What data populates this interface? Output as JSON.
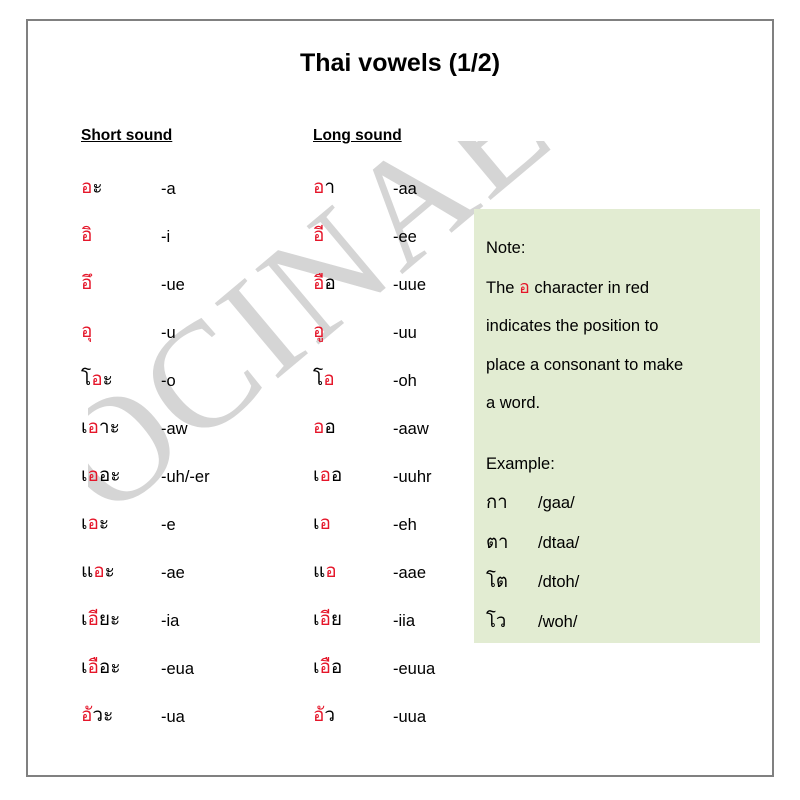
{
  "page": {
    "title": "Thai vowels (1/2)",
    "watermark": "OCINAE",
    "border_color": "#808080",
    "red_accent": "#e5162a",
    "note_bg": "#e2ecd2"
  },
  "columns": {
    "short_header": "Short sound",
    "long_header": "Long sound"
  },
  "short_sounds": [
    {
      "thai_pre": "",
      "thai_placeholder": "อ",
      "thai_post": "ะ",
      "roman": "-a"
    },
    {
      "thai_pre": "",
      "thai_placeholder": "อิ",
      "thai_post": "",
      "roman": "-i"
    },
    {
      "thai_pre": "",
      "thai_placeholder": "อึ",
      "thai_post": "",
      "roman": "-ue"
    },
    {
      "thai_pre": "",
      "thai_placeholder": "อุ",
      "thai_post": "",
      "roman": "-u"
    },
    {
      "thai_pre": "โ",
      "thai_placeholder": "อ",
      "thai_post": "ะ",
      "roman": "-o"
    },
    {
      "thai_pre": "เ",
      "thai_placeholder": "อ",
      "thai_post": "าะ",
      "roman": "-aw"
    },
    {
      "thai_pre": "เ",
      "thai_placeholder": "อ",
      "thai_post": "อะ",
      "roman": "-uh/-er"
    },
    {
      "thai_pre": "เ",
      "thai_placeholder": "อ",
      "thai_post": "ะ",
      "roman": "-e"
    },
    {
      "thai_pre": "แ",
      "thai_placeholder": "อ",
      "thai_post": "ะ",
      "roman": "-ae"
    },
    {
      "thai_pre": "เ",
      "thai_placeholder": "อี",
      "thai_post": "ยะ",
      "roman": "-ia"
    },
    {
      "thai_pre": "เ",
      "thai_placeholder": "อื",
      "thai_post": "อะ",
      "roman": "-eua"
    },
    {
      "thai_pre": "",
      "thai_placeholder": "อั",
      "thai_post": "วะ",
      "roman": "-ua"
    }
  ],
  "long_sounds": [
    {
      "thai_pre": "",
      "thai_placeholder": "อ",
      "thai_post": "า",
      "roman": "-aa"
    },
    {
      "thai_pre": "",
      "thai_placeholder": "อี",
      "thai_post": "",
      "roman": "-ee"
    },
    {
      "thai_pre": "",
      "thai_placeholder": "อื",
      "thai_post": "อ",
      "roman": "-uue"
    },
    {
      "thai_pre": "",
      "thai_placeholder": "อู",
      "thai_post": "",
      "roman": "-uu"
    },
    {
      "thai_pre": "โ",
      "thai_placeholder": "อ",
      "thai_post": "",
      "roman": "-oh"
    },
    {
      "thai_pre": "",
      "thai_placeholder": "อ",
      "thai_post": "อ",
      "roman": "-aaw"
    },
    {
      "thai_pre": "เ",
      "thai_placeholder": "อ",
      "thai_post": "อ",
      "roman": "-uuhr"
    },
    {
      "thai_pre": "เ",
      "thai_placeholder": "อ",
      "thai_post": "",
      "roman": "-eh"
    },
    {
      "thai_pre": "แ",
      "thai_placeholder": "อ",
      "thai_post": "",
      "roman": "-aae"
    },
    {
      "thai_pre": "เ",
      "thai_placeholder": "อี",
      "thai_post": "ย",
      "roman": "-iia"
    },
    {
      "thai_pre": "เ",
      "thai_placeholder": "อื",
      "thai_post": "อ",
      "roman": "-euua"
    },
    {
      "thai_pre": "",
      "thai_placeholder": "อั",
      "thai_post": "ว",
      "roman": "-uua"
    }
  ],
  "note": {
    "heading": "Note:",
    "line1_before": "The ",
    "line1_char": "อ",
    "line1_after": " character in red",
    "line2": "indicates the position to",
    "line3": "place a consonant to make",
    "line4": "a word.",
    "example_heading": "Example:",
    "examples": [
      {
        "thai": "กา",
        "roman": "/gaa/"
      },
      {
        "thai": "ตา",
        "roman": "/dtaa/"
      },
      {
        "thai": "โต",
        "roman": "/dtoh/"
      },
      {
        "thai": "โว",
        "roman": "/woh/"
      }
    ]
  }
}
